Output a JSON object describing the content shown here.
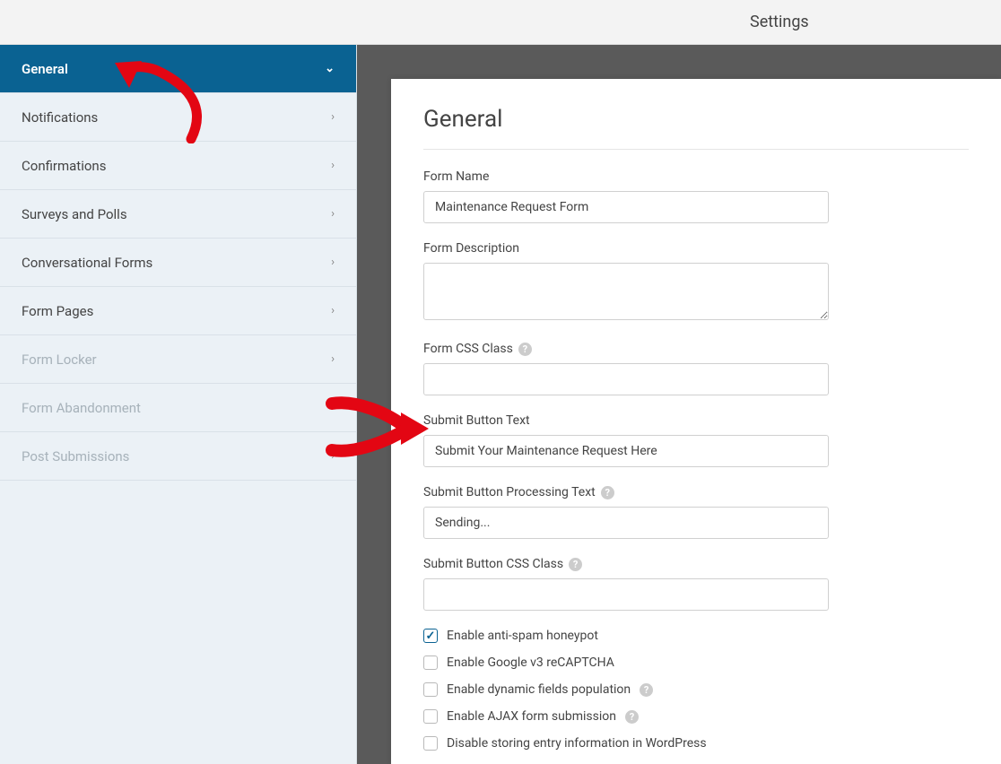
{
  "header": {
    "title": "Settings"
  },
  "sidebar": {
    "items": [
      {
        "label": "General",
        "active": true,
        "disabled": false
      },
      {
        "label": "Notifications",
        "active": false,
        "disabled": false
      },
      {
        "label": "Confirmations",
        "active": false,
        "disabled": false
      },
      {
        "label": "Surveys and Polls",
        "active": false,
        "disabled": false
      },
      {
        "label": "Conversational Forms",
        "active": false,
        "disabled": false
      },
      {
        "label": "Form Pages",
        "active": false,
        "disabled": false
      },
      {
        "label": "Form Locker",
        "active": false,
        "disabled": true
      },
      {
        "label": "Form Abandonment",
        "active": false,
        "disabled": true
      },
      {
        "label": "Post Submissions",
        "active": false,
        "disabled": true
      }
    ]
  },
  "panel": {
    "heading": "General",
    "fields": {
      "form_name": {
        "label": "Form Name",
        "value": "Maintenance Request Form"
      },
      "form_description": {
        "label": "Form Description",
        "value": ""
      },
      "form_css_class": {
        "label": "Form CSS Class",
        "value": "",
        "help": true
      },
      "submit_button_text": {
        "label": "Submit Button Text",
        "value": "Submit Your Maintenance Request Here"
      },
      "submit_button_processing": {
        "label": "Submit Button Processing Text",
        "value": "Sending...",
        "help": true
      },
      "submit_button_css": {
        "label": "Submit Button CSS Class",
        "value": "",
        "help": true
      }
    },
    "checkboxes": [
      {
        "label": "Enable anti-spam honeypot",
        "checked": true,
        "help": false
      },
      {
        "label": "Enable Google v3 reCAPTCHA",
        "checked": false,
        "help": false
      },
      {
        "label": "Enable dynamic fields population",
        "checked": false,
        "help": true
      },
      {
        "label": "Enable AJAX form submission",
        "checked": false,
        "help": true
      },
      {
        "label": "Disable storing entry information in WordPress",
        "checked": false,
        "help": false
      }
    ]
  }
}
